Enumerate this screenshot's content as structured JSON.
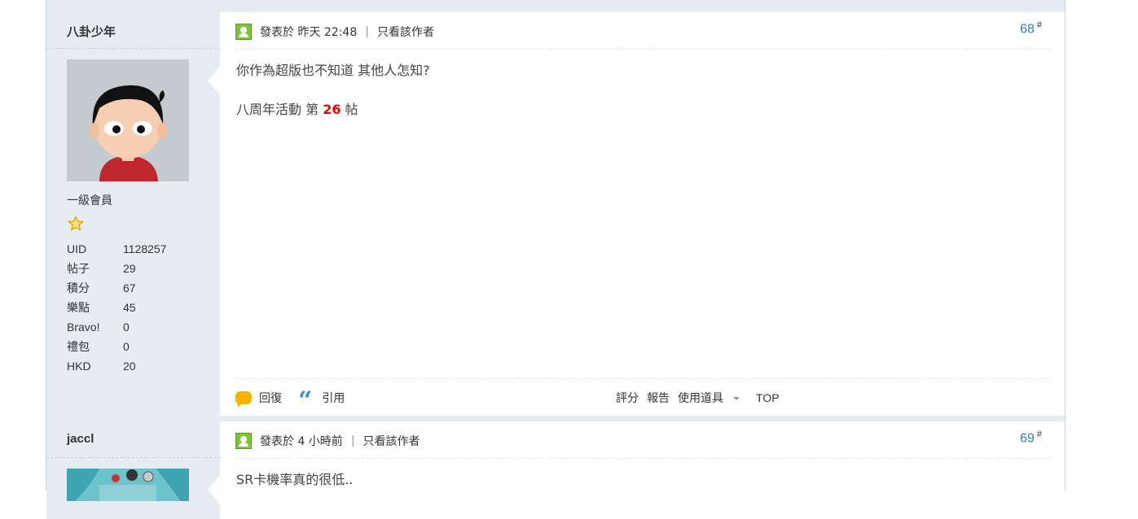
{
  "posts": [
    {
      "author": "八卦少年",
      "rank": "一級會員",
      "stats": [
        {
          "label": "UID",
          "value": "1128257"
        },
        {
          "label": "帖子",
          "value": "29"
        },
        {
          "label": "積分",
          "value": "67"
        },
        {
          "label": "樂點",
          "value": "45"
        },
        {
          "label": "Bravo!",
          "value": "0"
        },
        {
          "label": "禮包",
          "value": "0"
        },
        {
          "label": "HKD",
          "value": "20"
        }
      ],
      "posted": "發表於 昨天 22:48",
      "only_author": "只看該作者",
      "floor": "68",
      "floor_sup": "#",
      "line1": "你作為超版也不知道 其他人怎知?",
      "line2_prefix": "八周年活動 第",
      "line2_num": "26",
      "line2_suffix": "帖"
    },
    {
      "author": "jaccl",
      "posted": "發表於 4 小時前",
      "only_author": "只看該作者",
      "floor": "69",
      "floor_sup": "#",
      "line1": "SR卡機率真的很低.."
    }
  ],
  "actions": {
    "reply": "回復",
    "quote": "引用",
    "rate": "評分",
    "report": "報告",
    "use_item": "使用道具",
    "top": "TOP"
  },
  "separator": "|",
  "colors": {
    "floor": "#2b7fbf",
    "highlight": "#e00000",
    "sidebar": "#e5edf2"
  }
}
